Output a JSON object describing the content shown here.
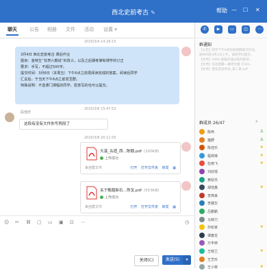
{
  "window": {
    "title": "西北史前考古",
    "controls": [
      "帮助",
      "—",
      "☐",
      "✕"
    ]
  },
  "tabs": [
    "聊天",
    "公告",
    "相册",
    "文件",
    "活动",
    "设置 ▾"
  ],
  "chat": {
    "t1": "2020/3/4 14:29:15",
    "msg1": [
      "3月4日 西北史前考古 课后作业",
      "题目：金特生“甘肃六期说”的改义，以及之后期考掌和课学的订正",
      "要求：手写，不超过500字。",
      "提交时间：3月6日（本周五）下午6点之前把阅读完成的答案，阅读后同学",
      "汇总后，于当天下午6点之前发至群。",
      "特殊说明：不选课门课程的同学，愿意写的也可以提交。"
    ],
    "sender": "段佳庆",
    "msg2": "这段有没有文件你写两段了",
    "t2": "2020/3/6 15:47:52",
    "t3": "2020/3/8 20:11:55",
    "files": [
      {
        "name": "大溪_古遗_西...陈翰.pdf",
        "size": "(100KB)",
        "status": "上传成功",
        "source": "来自群文件",
        "acts": [
          "打开",
          "打开文件夹",
          "转发",
          "▦"
        ]
      },
      {
        "name": "关于甄偃新石...然戈.pdf",
        "size": "(553KB)",
        "status": "上传成功",
        "source": "来自群文件",
        "acts": [
          "打开",
          "打开文件夹",
          "转发",
          "▦"
        ]
      }
    ]
  },
  "toolbar": {
    "icons": [
      "☺",
      "✂",
      "⌘",
      "▢",
      "▭",
      "▣",
      "⊡",
      "⋯",
      "◷"
    ]
  },
  "buttons": {
    "close": "关闭(C)",
    "send": "发送(S)",
    "send_arrow": "▾"
  },
  "right": {
    "notice_title": "群通知",
    "notice": [
      "【公告】同学下午6点前发到群提交作业，",
      "按时间在4月1日上午。请同学们提交。",
      "【文件】5000.金陵开通过程的影响...",
      "【文件】实验室聚一期考文献 1519...",
      "【文件】西北史前考古_第二讲.pdf"
    ],
    "members_title": "群成员 26/47",
    "members": [
      {
        "name": "陈冉",
        "mark": "♙",
        "color": "#f39c12"
      },
      {
        "name": "猫野",
        "mark": "♙",
        "color": "#e67e22"
      },
      {
        "name": "陈佳乐",
        "mark": "★",
        "color": "#d35400"
      },
      {
        "name": "程林锋",
        "mark": "★",
        "color": "#3498db"
      },
      {
        "name": "杜雨飞",
        "mark": "★",
        "color": "#e74c3c"
      },
      {
        "name": "刘欣璟",
        "mark": "",
        "color": "#8e44ad"
      },
      {
        "name": "黄钦杰",
        "mark": "",
        "color": "#16a085"
      },
      {
        "name": "胡佳鑫",
        "mark": "★",
        "color": "#34495e"
      },
      {
        "name": "李燕来",
        "mark": "",
        "color": "#c0392b"
      },
      {
        "name": "李钢华",
        "mark": "",
        "color": "#2980b9"
      },
      {
        "name": "吕鹏鹏",
        "mark": "",
        "color": "#27ae60"
      },
      {
        "name": "马钟力",
        "mark": "",
        "color": "#7f8c8d"
      },
      {
        "name": "孙钦家",
        "mark": "★",
        "color": "#f1c40f"
      },
      {
        "name": "谭春龙",
        "mark": "",
        "color": "#2c3e50"
      },
      {
        "name": "万丰婷",
        "mark": "",
        "color": "#9b59b6"
      },
      {
        "name": "王晓兰",
        "mark": "★",
        "color": "#1abc9c"
      },
      {
        "name": "王芝珍",
        "mark": "",
        "color": "#e67e22"
      },
      {
        "name": "王小菲",
        "mark": "★",
        "color": "#95a5a6"
      }
    ]
  }
}
